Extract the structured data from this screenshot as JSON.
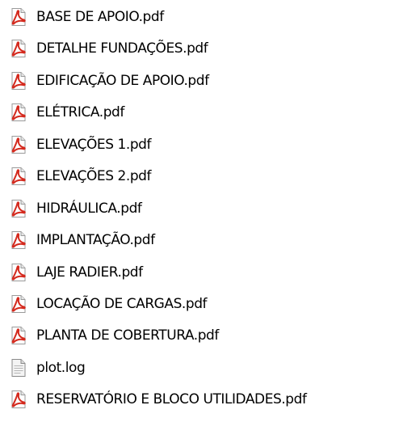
{
  "files": [
    {
      "name": "BASE DE APOIO.pdf",
      "icon": "pdf-file-icon"
    },
    {
      "name": "DETALHE FUNDAÇÕES.pdf",
      "icon": "pdf-file-icon"
    },
    {
      "name": "EDIFICAÇÃO DE APOIO.pdf",
      "icon": "pdf-file-icon"
    },
    {
      "name": "ELÉTRICA.pdf",
      "icon": "pdf-file-icon"
    },
    {
      "name": "ELEVAÇÕES 1.pdf",
      "icon": "pdf-file-icon"
    },
    {
      "name": "ELEVAÇÕES 2.pdf",
      "icon": "pdf-file-icon"
    },
    {
      "name": "HIDRÁULICA.pdf",
      "icon": "pdf-file-icon"
    },
    {
      "name": "IMPLANTAÇÃO.pdf",
      "icon": "pdf-file-icon"
    },
    {
      "name": "LAJE RADIER.pdf",
      "icon": "pdf-file-icon"
    },
    {
      "name": "LOCAÇÃO DE CARGAS.pdf",
      "icon": "pdf-file-icon"
    },
    {
      "name": "PLANTA DE COBERTURA.pdf",
      "icon": "pdf-file-icon"
    },
    {
      "name": "plot.log",
      "icon": "text-file-icon"
    },
    {
      "name": "RESERVATÓRIO E BLOCO UTILIDADES.pdf",
      "icon": "pdf-file-icon"
    }
  ],
  "colors": {
    "pdf_icon_red": "#d42a1e",
    "page_gray": "#f4f4f4"
  }
}
